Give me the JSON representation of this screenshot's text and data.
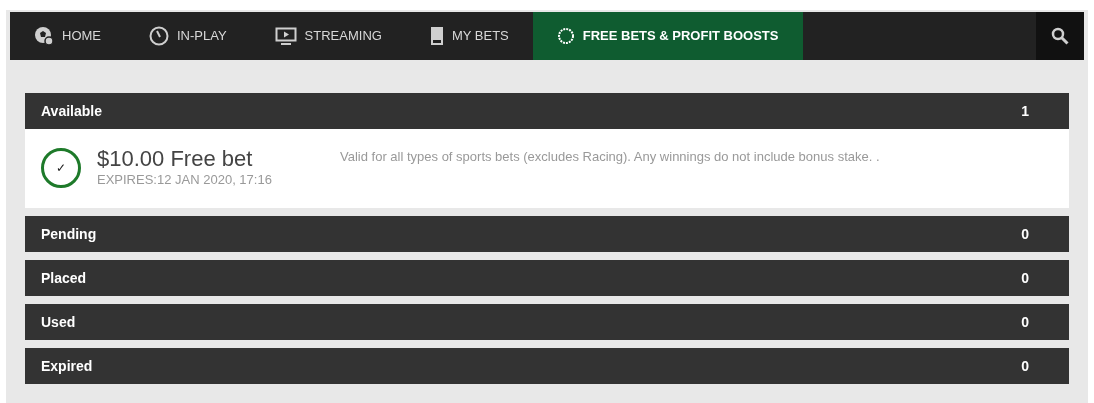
{
  "nav": {
    "items": [
      {
        "label": "HOME",
        "kind": "ball",
        "selected": false
      },
      {
        "label": "IN-PLAY",
        "kind": "gauge",
        "selected": false
      },
      {
        "label": "STREAMING",
        "kind": "screen",
        "selected": false
      },
      {
        "label": "MY BETS",
        "kind": "slip",
        "selected": false
      },
      {
        "label": "FREE BETS & PROFIT BOOSTS",
        "kind": "ring",
        "selected": true
      }
    ]
  },
  "sections": [
    {
      "title": "Available",
      "count": "1",
      "offers": [
        {
          "mark": "✓",
          "amount": "$10.00 Free bet",
          "expires": "EXPIRES:12 JAN 2020, 17:16",
          "terms": "Valid for all types of sports bets (excludes Racing). Any winnings do not include bonus stake. ."
        }
      ]
    },
    {
      "title": "Pending",
      "count": "0"
    },
    {
      "title": "Placed",
      "count": "0"
    },
    {
      "title": "Used",
      "count": "0"
    },
    {
      "title": "Expired",
      "count": "0"
    }
  ]
}
